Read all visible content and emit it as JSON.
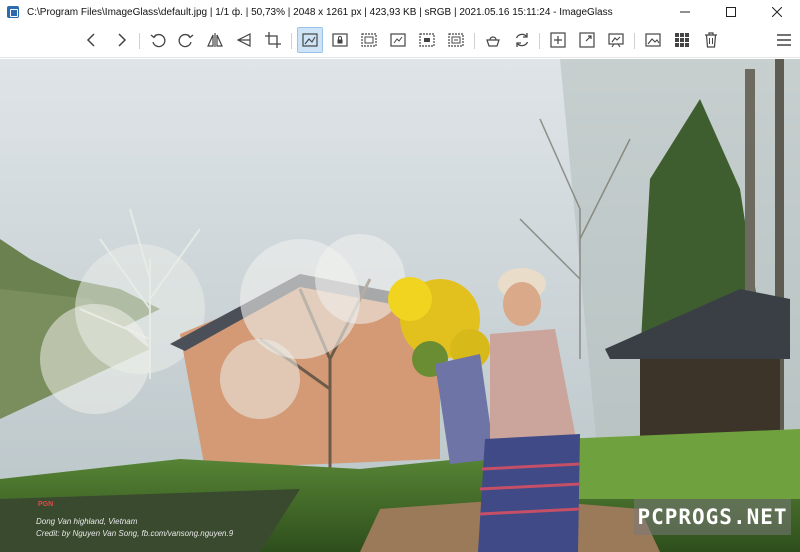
{
  "window": {
    "title": "C:\\Program Files\\ImageGlass\\default.jpg  |  1/1 ф.  |  50,73%  |  2048 x 1261 px  |  423,93 KB  |  sRGB  |  2021.05.16 15:11:24  -  ImageGlass"
  },
  "toolbar": {
    "active_button": "zoom-to-fit",
    "buttons": [
      {
        "id": "prev",
        "icon": "chevron-left-icon"
      },
      {
        "id": "next",
        "icon": "chevron-right-icon"
      },
      {
        "id": "rotate-left",
        "icon": "rotate-left-icon"
      },
      {
        "id": "rotate-right",
        "icon": "rotate-right-icon"
      },
      {
        "id": "flip-horizontal",
        "icon": "flip-horizontal-icon"
      },
      {
        "id": "flip-vertical",
        "icon": "flip-vertical-icon"
      },
      {
        "id": "crop",
        "icon": "crop-icon"
      },
      {
        "id": "zoom-to-fit",
        "icon": "zoom-fit-icon"
      },
      {
        "id": "lock-zoom",
        "icon": "lock-zoom-icon"
      },
      {
        "id": "scale-width",
        "icon": "scale-width-icon"
      },
      {
        "id": "scale-height",
        "icon": "scale-height-icon"
      },
      {
        "id": "auto-zoom",
        "icon": "auto-zoom-icon"
      },
      {
        "id": "actual-size",
        "icon": "actual-size-icon"
      },
      {
        "id": "checkerboard",
        "icon": "checkerboard-icon"
      },
      {
        "id": "refresh",
        "icon": "refresh-icon"
      },
      {
        "id": "gallery",
        "icon": "gallery-icon"
      },
      {
        "id": "fullscreen",
        "icon": "fullscreen-icon"
      },
      {
        "id": "slideshow",
        "icon": "slideshow-icon"
      },
      {
        "id": "set-wallpaper",
        "icon": "image-icon"
      },
      {
        "id": "thumbnails",
        "icon": "grid-icon"
      },
      {
        "id": "delete",
        "icon": "trash-icon"
      },
      {
        "id": "menu",
        "icon": "hamburger-menu-icon"
      }
    ]
  },
  "photo": {
    "caption_mark": "PGN",
    "caption_line1": "Dong Van highland, Vietnam",
    "caption_line2": "Credit: by Nguyen Van Song, fb.com/vansong.nguyen.9"
  },
  "watermark": {
    "text": "PCPROGS.NET"
  },
  "colors": {
    "active_button_bg": "#cfe3f7",
    "icon_stroke": "#444444",
    "sky": "#c9d3d8",
    "wall": "#d39a75"
  }
}
